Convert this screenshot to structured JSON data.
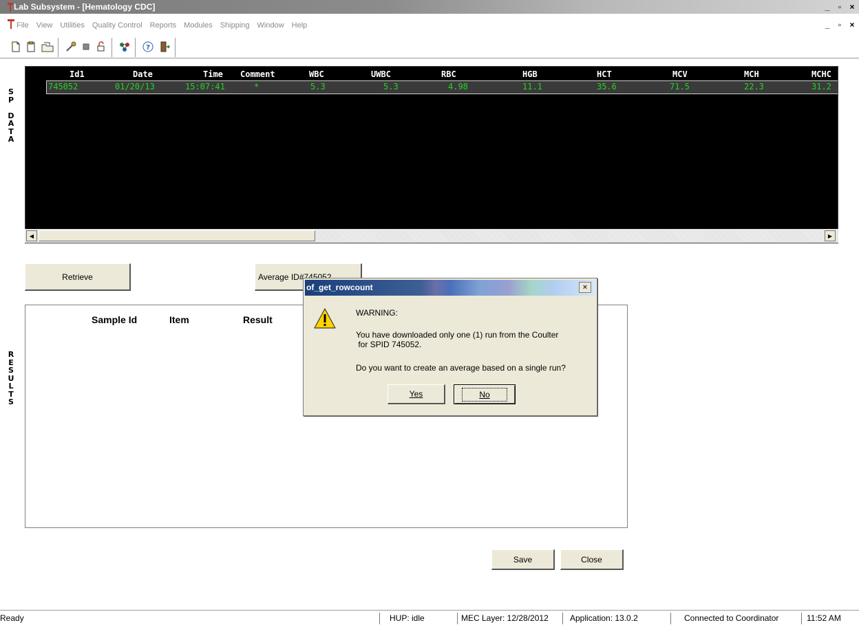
{
  "window": {
    "title": "Lab Subsystem - [Hematology CDC]",
    "controls": {
      "minimize": "_",
      "maximize": "▫",
      "close": "×"
    }
  },
  "menu": {
    "items": [
      {
        "label": "File"
      },
      {
        "label": "View"
      },
      {
        "label": "Utilities"
      },
      {
        "label": "Quality Control"
      },
      {
        "label": "Reports"
      },
      {
        "label": "Modules"
      },
      {
        "label": "Shipping"
      },
      {
        "label": "Window"
      },
      {
        "label": "Help"
      }
    ]
  },
  "toolbar": {
    "icons": [
      "new-document-icon",
      "clipboard-icon",
      "open-folder-icon",
      "pipette-icon",
      "stop-icon",
      "unlock-icon",
      "network-icon",
      "help-icon",
      "exit-door-icon"
    ]
  },
  "side_labels": {
    "sp_data": [
      "S",
      "P",
      "",
      "D",
      "A",
      "T",
      "A"
    ],
    "results": [
      "R",
      "E",
      "S",
      "U",
      "L",
      "T",
      "S"
    ]
  },
  "grid": {
    "columns": [
      "Id1",
      "Date",
      "Time",
      "Comment",
      "WBC",
      "UWBC",
      "RBC",
      "HGB",
      "HCT",
      "MCV",
      "MCH",
      "MCHC"
    ],
    "rows": [
      [
        "745052",
        "01/20/13",
        "15:07:41",
        "*",
        "5.3",
        "5.3",
        "4.98",
        "11.1",
        "35.6",
        "71.5",
        "22.3",
        "31.2"
      ]
    ]
  },
  "buttons": {
    "retrieve": "Retrieve",
    "average": "Average ID#745052",
    "save": "Save",
    "close": "Close"
  },
  "results": {
    "columns": [
      "Sample Id",
      "Item",
      "Result"
    ]
  },
  "dialog": {
    "title": "of_get_rowcount",
    "close": "×",
    "line1": "WARNING:",
    "line2": "You have downloaded only one (1) run from the Coulter",
    "line3": " for SPID 745052.",
    "line4": "Do you want to create an average based on a single run?",
    "yes": "Yes",
    "no": "No"
  },
  "status": {
    "ready": "Ready",
    "hup": "HUP: idle",
    "mec": "MEC Layer: 12/28/2012",
    "app": "Application: 13.0.2",
    "connection": "Connected to Coordinator",
    "time": "11:52 AM"
  }
}
